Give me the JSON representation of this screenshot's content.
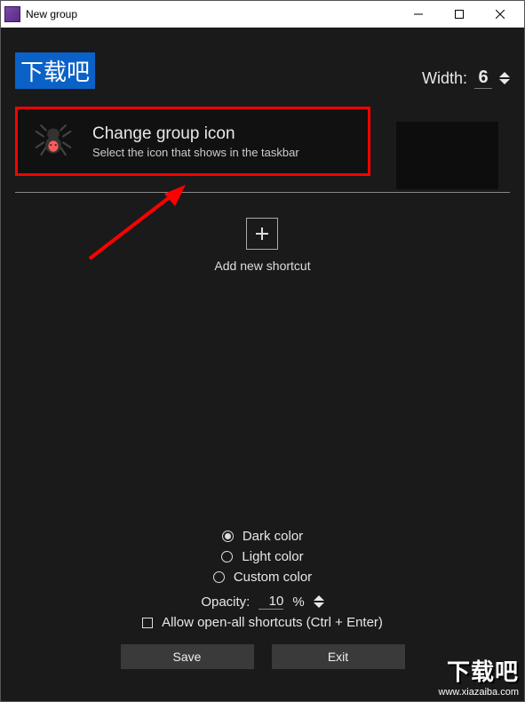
{
  "window": {
    "title": "New group"
  },
  "group": {
    "name": "下载吧",
    "width_label": "Width:",
    "width_value": "6"
  },
  "change_icon": {
    "title": "Change group icon",
    "subtitle": "Select the icon that shows in the taskbar"
  },
  "shortcut": {
    "add_label": "Add new shortcut"
  },
  "options": {
    "dark_label": "Dark color",
    "light_label": "Light color",
    "custom_label": "Custom color",
    "opacity_label": "Opacity:",
    "opacity_value": "10",
    "opacity_suffix": "%",
    "allow_open_all_label": "Allow open-all shortcuts (Ctrl + Enter)"
  },
  "buttons": {
    "save": "Save",
    "exit": "Exit"
  },
  "watermark": {
    "big": "下载吧",
    "small": "www.xiazaiba.com"
  }
}
